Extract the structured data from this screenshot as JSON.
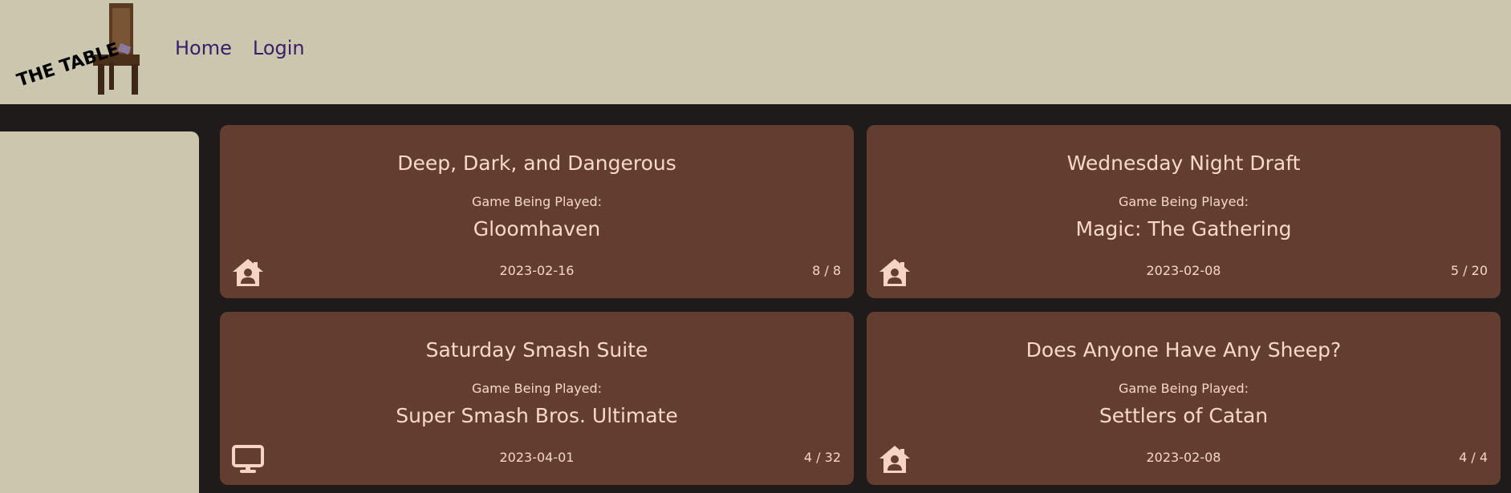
{
  "header": {
    "logo_text": "THE TABLE",
    "nav": [
      {
        "label": "Home"
      },
      {
        "label": "Login"
      }
    ]
  },
  "colors": {
    "header_bg": "#cbc6ae",
    "page_bg": "#1f1b1a",
    "card_bg": "#623d30",
    "card_text": "#f7d9c8",
    "nav_text": "#3b1e6b"
  },
  "cards": [
    {
      "title": "Deep, Dark, and Dangerous",
      "subtitle": "Game Being Played:",
      "game": "Gloomhaven",
      "date": "2023-02-16",
      "count": "8 / 8",
      "icon": "home-user-icon"
    },
    {
      "title": "Wednesday Night Draft",
      "subtitle": "Game Being Played:",
      "game": "Magic: The Gathering",
      "date": "2023-02-08",
      "count": "5 / 20",
      "icon": "home-user-icon"
    },
    {
      "title": "Saturday Smash Suite",
      "subtitle": "Game Being Played:",
      "game": "Super Smash Bros. Ultimate",
      "date": "2023-04-01",
      "count": "4 / 32",
      "icon": "monitor-icon"
    },
    {
      "title": "Does Anyone Have Any Sheep?",
      "subtitle": "Game Being Played:",
      "game": "Settlers of Catan",
      "date": "2023-02-08",
      "count": "4 / 4",
      "icon": "home-user-icon"
    }
  ]
}
